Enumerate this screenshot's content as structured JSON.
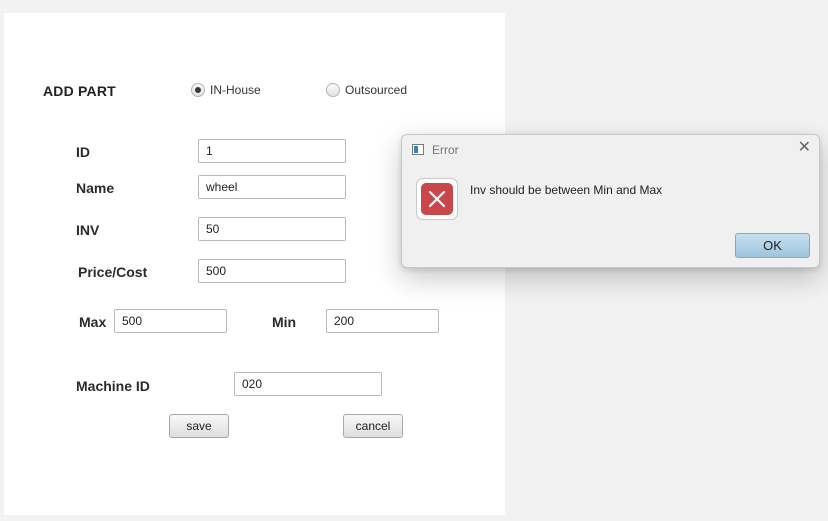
{
  "form": {
    "title": "ADD PART",
    "radio_inhouse": "IN-House",
    "radio_outsourced": "Outsourced",
    "labels": {
      "id": "ID",
      "name": "Name",
      "inv": "INV",
      "price": "Price/Cost",
      "max": "Max",
      "min": "Min",
      "machine_id": "Machine ID"
    },
    "values": {
      "id": "1",
      "name": "wheel",
      "inv": "50",
      "price": "500",
      "max": "500",
      "min": "200",
      "machine_id": "020"
    },
    "save_label": "save",
    "cancel_label": "cancel"
  },
  "dialog": {
    "title": "Error",
    "message": "Inv should be between Min and Max",
    "ok_label": "OK",
    "close_glyph": "✕"
  },
  "icons": {
    "error": "error-x-icon",
    "app": "app-window-icon",
    "close": "close-icon"
  },
  "colors": {
    "error_red": "#c9474a",
    "ok_button": "#b4d4ea"
  }
}
